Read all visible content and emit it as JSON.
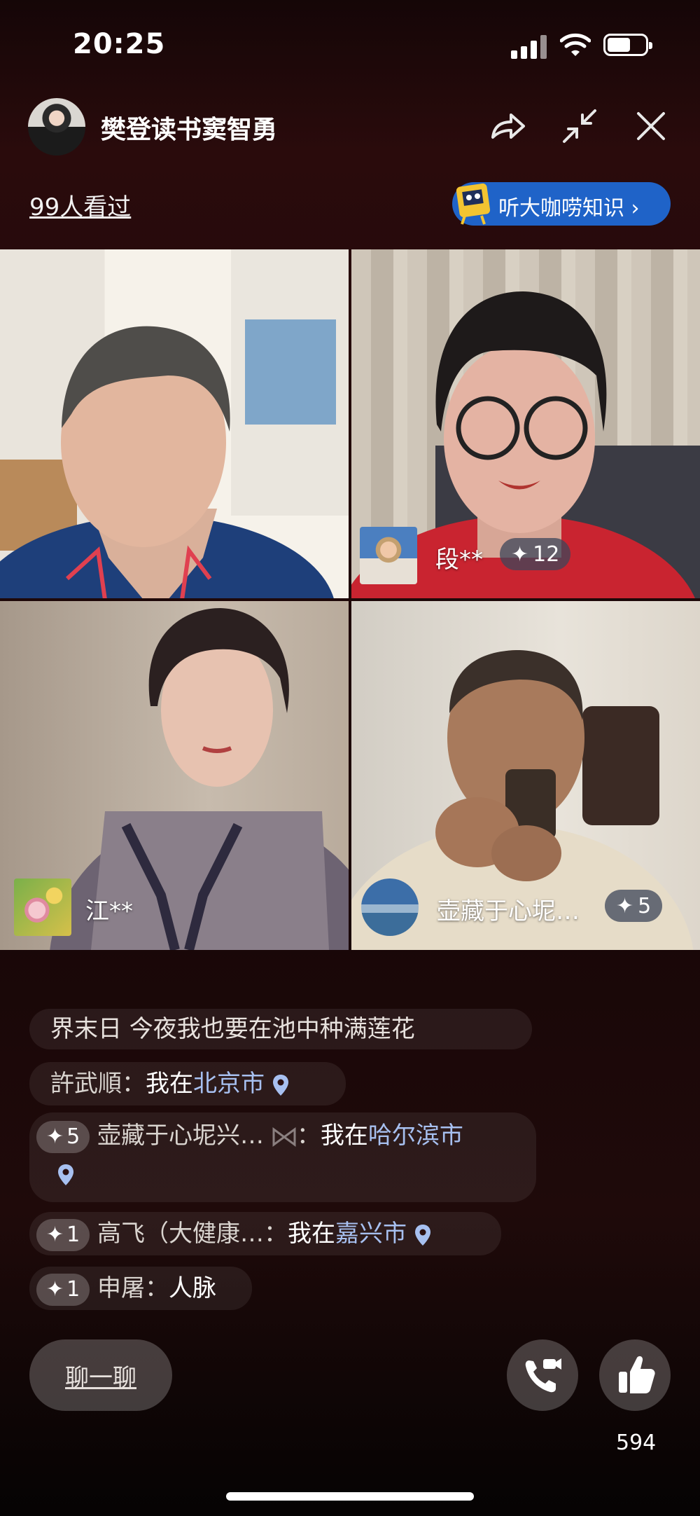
{
  "status_bar": {
    "time": "20:25"
  },
  "header": {
    "host_name": "樊登读书窦智勇",
    "viewers": "99人看过",
    "promo_label": "听大咖唠知识 ›"
  },
  "participants": [
    {
      "name": "",
      "score": ""
    },
    {
      "name": "段**",
      "score": "12"
    },
    {
      "name": "江**",
      "score": ""
    },
    {
      "name": "壶藏于心坭…",
      "score": "5"
    }
  ],
  "chat": {
    "messages": [
      {
        "text": "界末日 今夜我也要在池中种满莲花"
      },
      {
        "user": "許武順：",
        "prefix": "我在",
        "city": "北京市"
      },
      {
        "badge": "5",
        "user": "壶藏于心坭兴…",
        "sep": "：",
        "prefix": "我在",
        "city": "哈尔滨市"
      },
      {
        "badge": "1",
        "user": "高飞（大健康…：",
        "prefix": "我在",
        "city": "嘉兴市"
      },
      {
        "badge": "1",
        "user": "申屠：",
        "text": "人脉"
      }
    ]
  },
  "controls": {
    "chat_button": "聊一聊",
    "like_count": "594"
  }
}
